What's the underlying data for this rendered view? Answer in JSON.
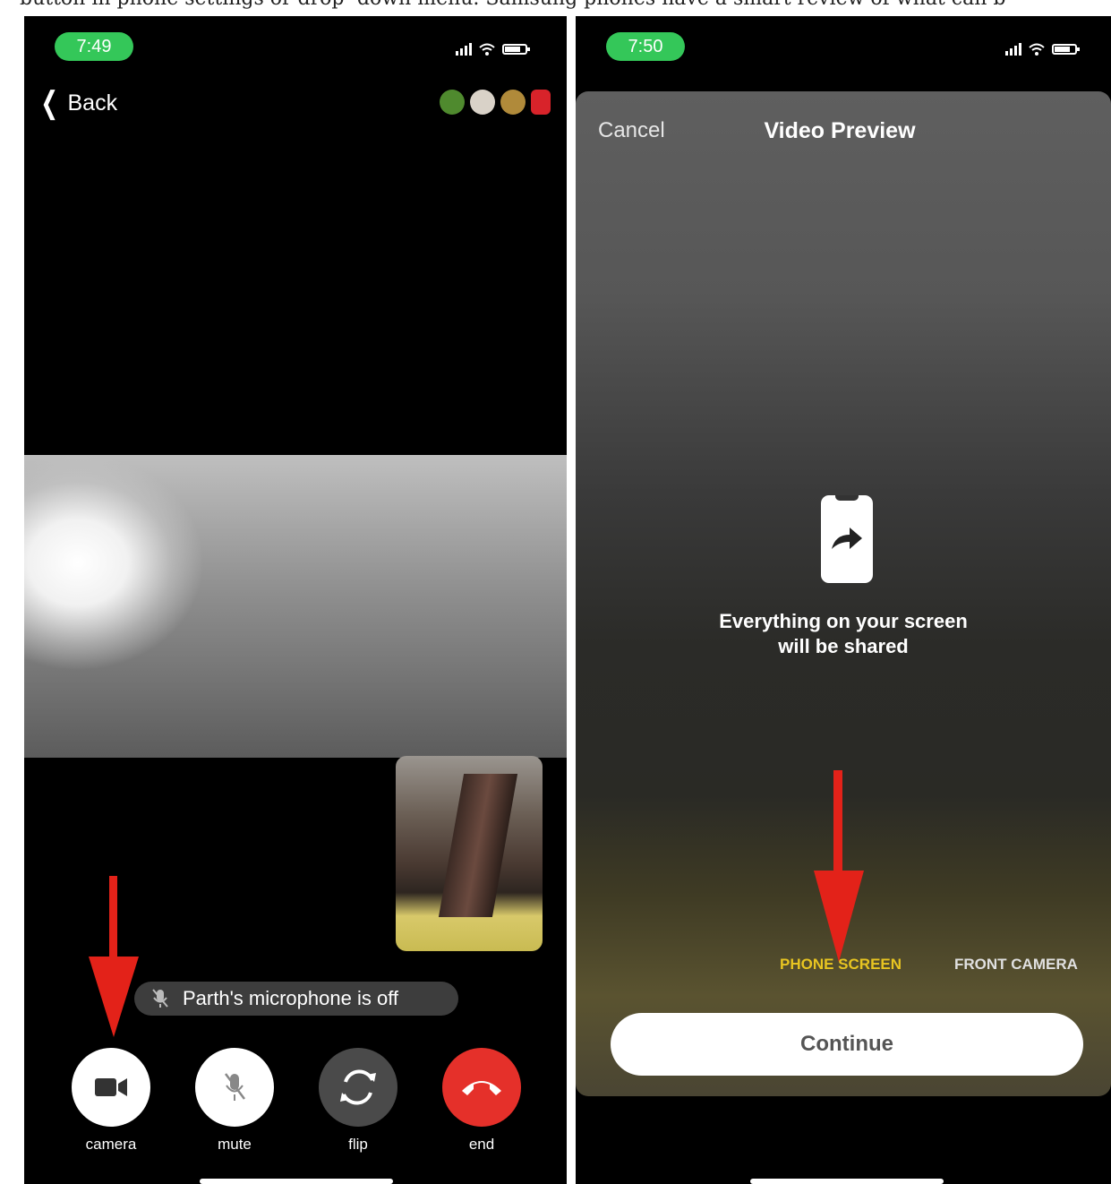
{
  "caption": "button in phone settings or drop -down menu. Samsung phones have a smart review of what can b",
  "left_screen": {
    "time": "7:49",
    "back_label": "Back",
    "toast_text": "Parth's microphone is off",
    "controls": [
      {
        "label": "camera",
        "icon": "video-camera-icon"
      },
      {
        "label": "mute",
        "icon": "microphone-off-icon"
      },
      {
        "label": "flip",
        "icon": "flip-camera-icon"
      },
      {
        "label": "end",
        "icon": "end-call-icon"
      }
    ]
  },
  "right_screen": {
    "time": "7:50",
    "cancel_label": "Cancel",
    "title": "Video Preview",
    "share_text_line1": "Everything on your screen",
    "share_text_line2": "will be shared",
    "source_options": [
      "PHONE SCREEN",
      "FRONT CAMERA"
    ],
    "selected_source": "PHONE SCREEN",
    "continue_label": "Continue"
  },
  "colors": {
    "status_green": "#34c759",
    "end_call_red": "#e5302a",
    "arrow_red": "#e32219",
    "selected_source_yellow": "#e8c521"
  }
}
